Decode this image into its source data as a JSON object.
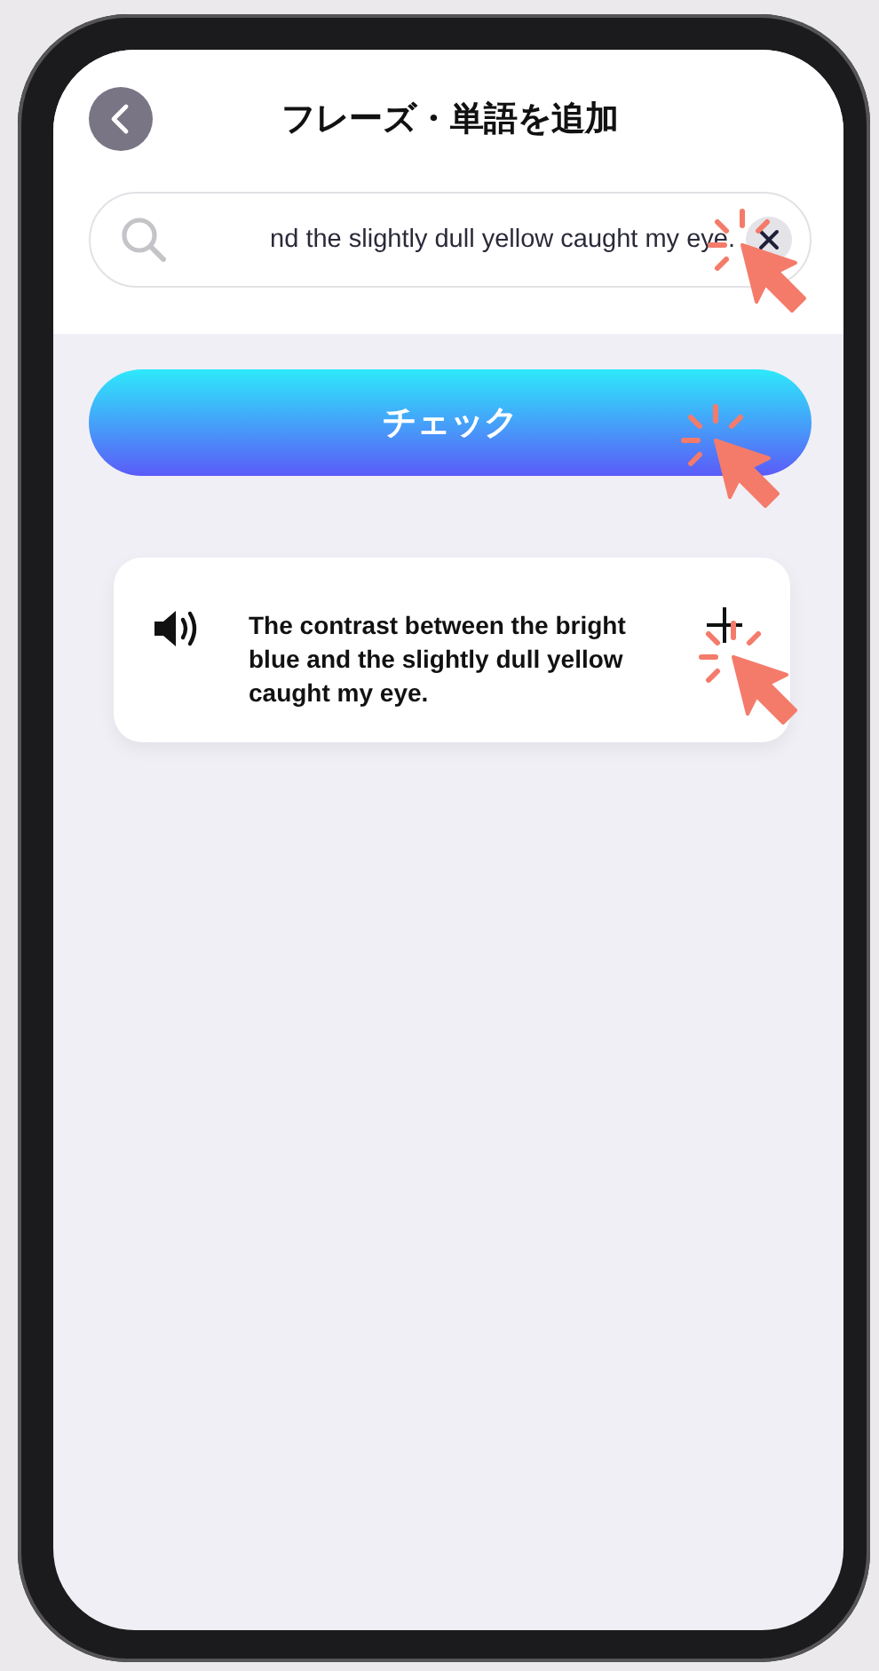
{
  "header": {
    "title": "フレーズ・単語を追加"
  },
  "search": {
    "value": "nd the slightly dull yellow caught my eye."
  },
  "check_button": {
    "label": "チェック"
  },
  "result": {
    "text": "The contrast between the bright blue and the slightly dull yellow caught my eye."
  }
}
